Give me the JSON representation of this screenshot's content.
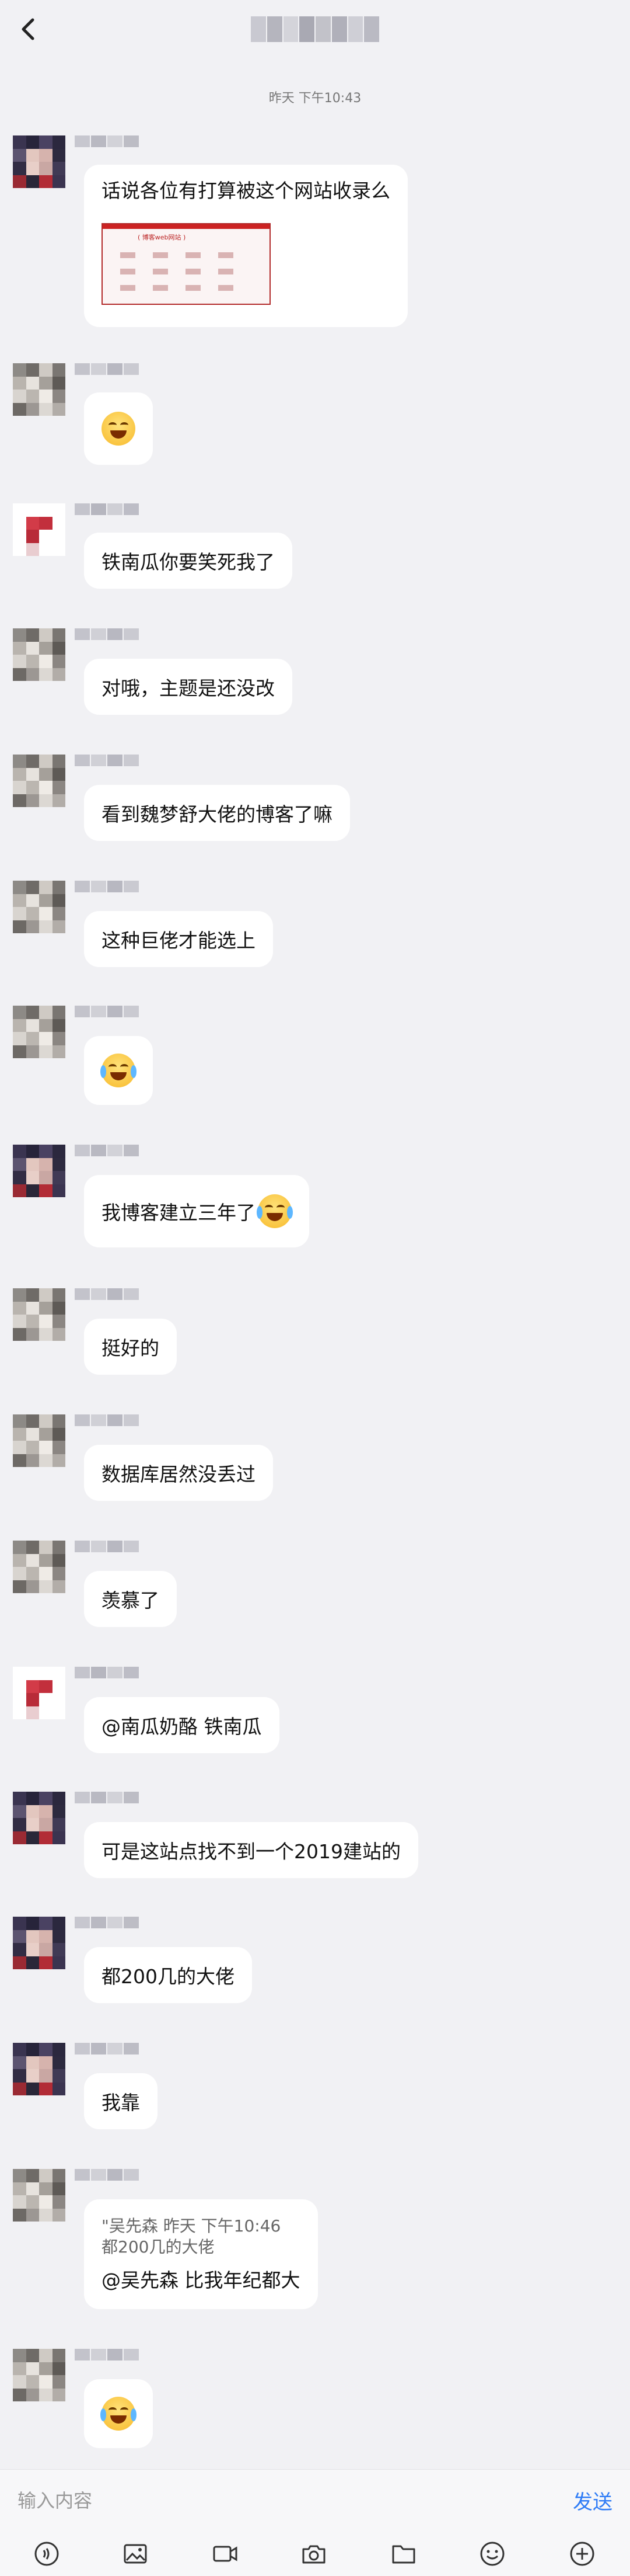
{
  "header": {
    "title_obscured": true
  },
  "timestamp": "昨天 下午10:43",
  "messages": [
    {
      "text": "话说各位有打算被这个网站收录么",
      "image_caption": "( 博客web网站 )"
    },
    {
      "emoji": "grin-smile"
    },
    {
      "text": "铁南瓜你要笑死我了"
    },
    {
      "text": "对哦，主题是还没改"
    },
    {
      "text": "看到魏梦舒大佬的博客了嘛"
    },
    {
      "text": "这种巨佬才能选上"
    },
    {
      "emoji": "tears-of-joy"
    },
    {
      "text": "我博客建立三年了"
    },
    {
      "text": "挺好的"
    },
    {
      "text": "数据库居然没丢过"
    },
    {
      "text": "羡慕了"
    },
    {
      "text": "@南瓜奶酪 铁南瓜"
    },
    {
      "text": "可是这站点找不到一个2019建站的"
    },
    {
      "text": "都200几的大佬"
    },
    {
      "text": "我靠"
    },
    {
      "quote_header": "\"吴先森 昨天 下午10:46",
      "quote_body": "都200几的大佬",
      "text": "@吴先森 比我年纪都大"
    },
    {
      "emoji": "tears-of-joy"
    }
  ],
  "composer": {
    "placeholder": "输入内容",
    "send_label": "发送",
    "icons": [
      "voice-icon",
      "image-icon",
      "video-icon",
      "camera-icon",
      "folder-icon",
      "emoji-icon",
      "plus-icon"
    ]
  },
  "colors": {
    "background": "#f1f1f4",
    "bubble": "#ffffff",
    "send": "#2f7cf6"
  }
}
